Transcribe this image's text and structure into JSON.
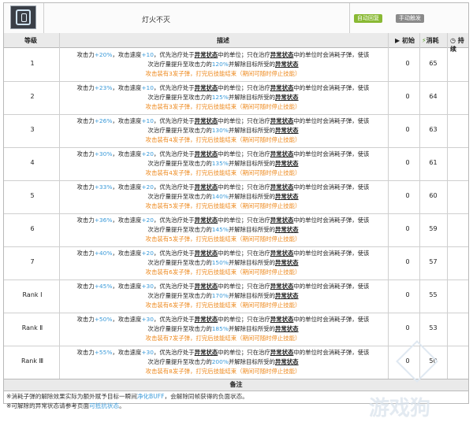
{
  "skill": {
    "name": "灯火不灭",
    "tags": [
      "自动回复",
      "手动触发"
    ],
    "icon": "lamp-icon"
  },
  "table": {
    "headers": {
      "level": "等级",
      "desc": "描述",
      "init": "初始",
      "cost": "消耗",
      "duration": "持续"
    },
    "rows": [
      {
        "level": "1",
        "atk": "+20%",
        "spd": "+10",
        "ratio": "120%",
        "ammo": "3",
        "init": "0",
        "cost": "65"
      },
      {
        "level": "2",
        "atk": "+23%",
        "spd": "+10",
        "ratio": "125%",
        "ammo": "3",
        "init": "0",
        "cost": "64"
      },
      {
        "level": "3",
        "atk": "+26%",
        "spd": "+10",
        "ratio": "130%",
        "ammo": "4",
        "init": "0",
        "cost": "63"
      },
      {
        "level": "4",
        "atk": "+30%",
        "spd": "+20",
        "ratio": "135%",
        "ammo": "4",
        "init": "0",
        "cost": "61"
      },
      {
        "level": "5",
        "atk": "+33%",
        "spd": "+20",
        "ratio": "140%",
        "ammo": "5",
        "init": "0",
        "cost": "60"
      },
      {
        "level": "6",
        "atk": "+36%",
        "spd": "+20",
        "ratio": "145%",
        "ammo": "5",
        "init": "0",
        "cost": "59"
      },
      {
        "level": "7",
        "atk": "+40%",
        "spd": "+20",
        "ratio": "150%",
        "ammo": "6",
        "init": "0",
        "cost": "57"
      },
      {
        "level": "Rank Ⅰ",
        "atk": "+45%",
        "spd": "+30",
        "ratio": "170%",
        "ammo": "6",
        "init": "0",
        "cost": "55"
      },
      {
        "level": "Rank Ⅱ",
        "atk": "+50%",
        "spd": "+30",
        "ratio": "185%",
        "ammo": "7",
        "init": "0",
        "cost": "53"
      },
      {
        "level": "Rank Ⅲ",
        "atk": "+55%",
        "spd": "+30",
        "ratio": "200%",
        "ammo": "8",
        "init": "0",
        "cost": "50"
      }
    ],
    "desc_text": {
      "p1": "攻击力",
      "p2": "，攻击速度",
      "p3": "，优先治疗处于",
      "status": "异常状态",
      "p4": "中的单位；只在治疗",
      "p5": "中的单位时会消耗子弹，使该",
      "p6": "次治疗量提升至攻击力的",
      "p7": "并解除目标所受的",
      "p8a": "攻击装有",
      "p8b": "发子弹，打完后技能结束（期间可随时停止技能）"
    }
  },
  "footer": {
    "title": "备注",
    "note1_pre": "※消耗子弹的解除效果实际为额外赋予目标一瞬间",
    "note1_link": "净化BUFF",
    "note1_post": "，会解除同帧获得的负面状态。",
    "note2_pre": "※可解除的异常状态请参考页面",
    "note2_link": "可抵抗状态",
    "note2_post": "。"
  },
  "watermark": "游戏狗"
}
